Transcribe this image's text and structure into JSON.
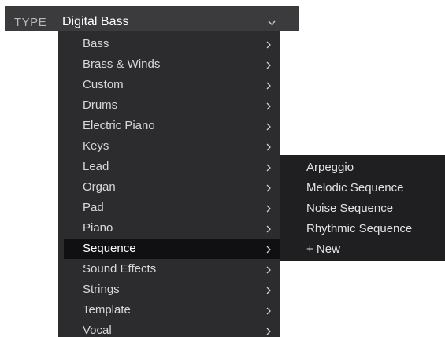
{
  "type_selector": {
    "label": "TYPE",
    "value": "Digital Bass"
  },
  "menu": {
    "items": [
      {
        "label": "Bass",
        "selected": false
      },
      {
        "label": "Brass & Winds",
        "selected": false
      },
      {
        "label": "Custom",
        "selected": false
      },
      {
        "label": "Drums",
        "selected": false
      },
      {
        "label": "Electric Piano",
        "selected": false
      },
      {
        "label": "Keys",
        "selected": false
      },
      {
        "label": "Lead",
        "selected": false
      },
      {
        "label": "Organ",
        "selected": false
      },
      {
        "label": "Pad",
        "selected": false
      },
      {
        "label": "Piano",
        "selected": false
      },
      {
        "label": "Sequence",
        "selected": true
      },
      {
        "label": "Sound Effects",
        "selected": false
      },
      {
        "label": "Strings",
        "selected": false
      },
      {
        "label": "Template",
        "selected": false
      },
      {
        "label": "Vocal",
        "selected": false
      }
    ]
  },
  "submenu": {
    "items": [
      {
        "label": "Arpeggio"
      },
      {
        "label": "Melodic Sequence"
      },
      {
        "label": "Noise Sequence"
      },
      {
        "label": "Rhythmic Sequence"
      },
      {
        "label": "+ New"
      }
    ]
  },
  "icons": {
    "dropdown": "chevron-down-icon",
    "submenu_arrow": "chevron-right-icon"
  },
  "colors": {
    "bar_bg": "#3b3b3d",
    "menu_bg": "#2c2c2f",
    "submenu_bg": "#1f1f22",
    "selected_bg": "#101012"
  }
}
